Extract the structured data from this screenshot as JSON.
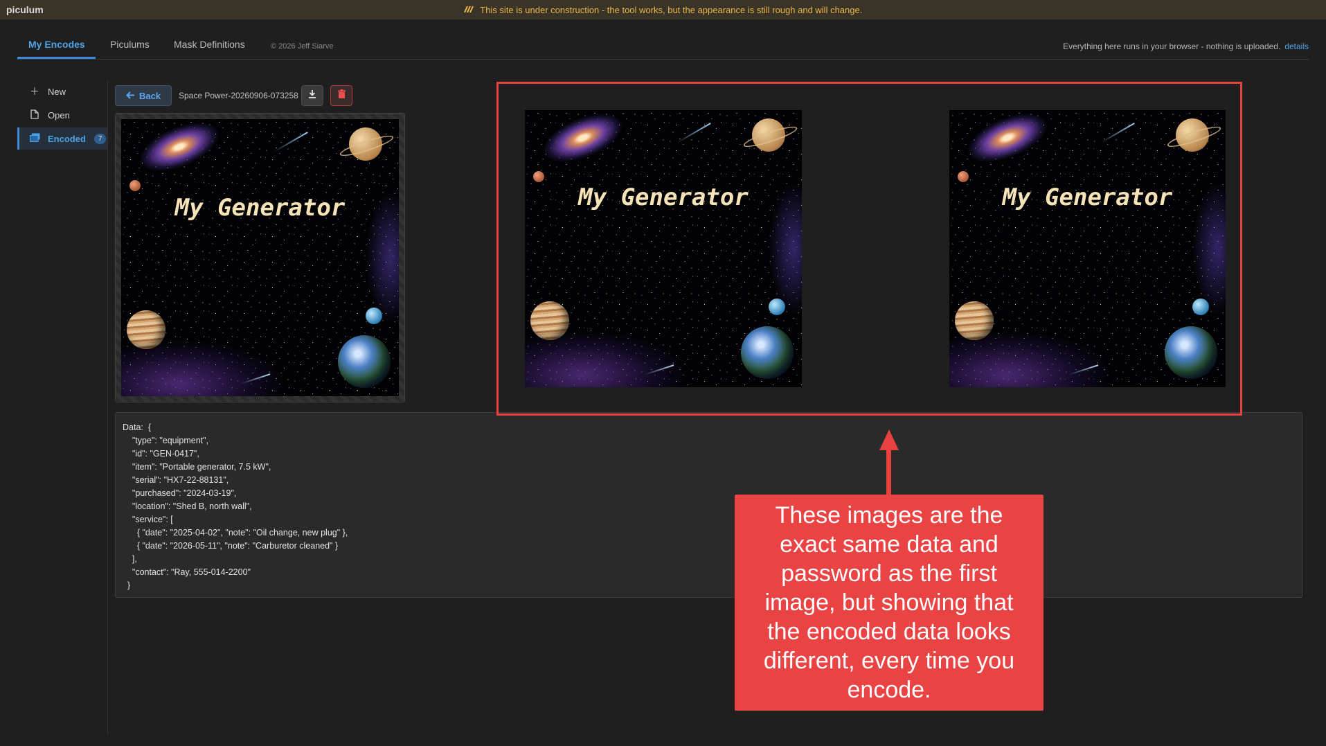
{
  "app": {
    "name": "piculum"
  },
  "banner": {
    "icon": "construction-icon",
    "text": "This site is under construction - the tool works, but the appearance is still rough and will change."
  },
  "tabs": [
    {
      "label": "My Encodes",
      "active": true
    },
    {
      "label": "Piculums",
      "active": false
    },
    {
      "label": "Mask Definitions",
      "active": false
    }
  ],
  "copyright": "© 2026 Jeff Siarve",
  "privacy": {
    "text": "Everything here runs in your browser - nothing is uploaded.",
    "link": "details"
  },
  "sidebar": {
    "items": [
      {
        "label": "New",
        "icon": "plus-icon"
      },
      {
        "label": "Open",
        "icon": "file-icon"
      },
      {
        "label": "Encoded",
        "icon": "images-icon",
        "badge": "7",
        "active": true
      }
    ]
  },
  "toolbar": {
    "back_label": "Back",
    "filename": "Space Power-20260906-073258",
    "download_icon": "download-icon",
    "delete_icon": "trash-icon"
  },
  "image": {
    "title": "My Generator"
  },
  "compare": [
    {
      "title": "My Generator"
    },
    {
      "title": "My Generator"
    }
  ],
  "data_panel": {
    "text": "Data:  {\n    \"type\": \"equipment\",\n    \"id\": \"GEN-0417\",\n    \"item\": \"Portable generator, 7.5 kW\",\n    \"serial\": \"HX7-22-88131\",\n    \"purchased\": \"2024-03-19\",\n    \"location\": \"Shed B, north wall\",\n    \"service\": [\n      { \"date\": \"2025-04-02\", \"note\": \"Oil change, new plug\" },\n      { \"date\": \"2026-05-11\", \"note\": \"Carburetor cleaned\" }\n    ],\n    \"contact\": \"Ray, 555-014-2200\"\n  }"
  },
  "annotation": {
    "text": "These images are the exact same data and password as the first image, but showing that the encoded data looks different, every time you encode.",
    "color": "#ea4343"
  },
  "colors": {
    "accent": "#3b8ad9",
    "warning": "#e8b84a",
    "highlight": "#e8413f"
  }
}
